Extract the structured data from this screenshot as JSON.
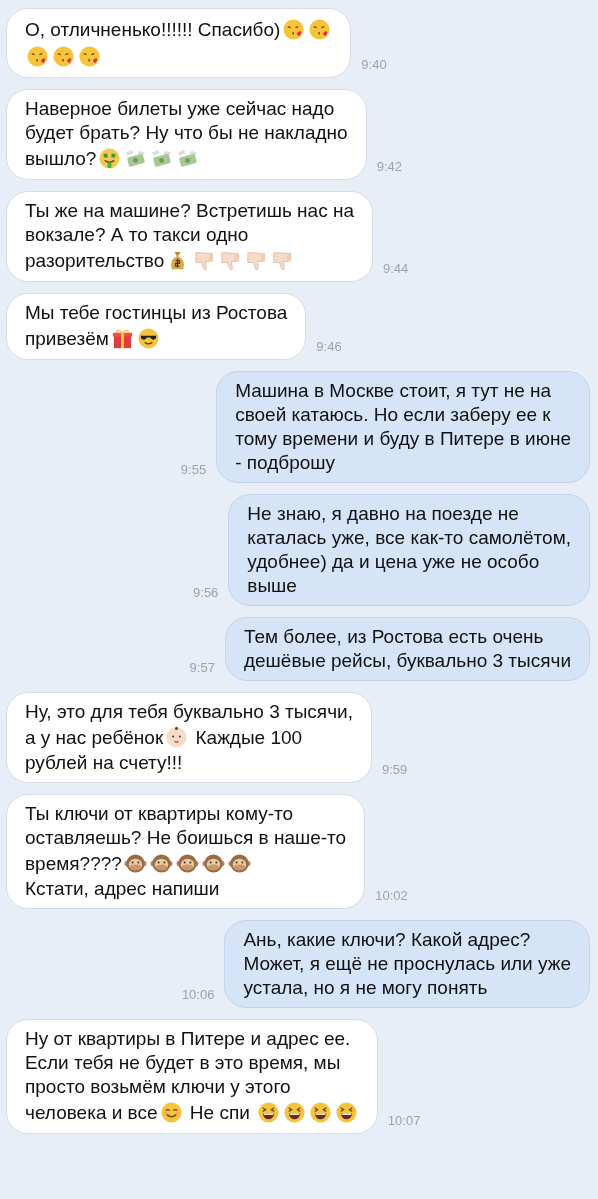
{
  "messages": [
    {
      "outgoing": false,
      "time": "9:40",
      "lines": [
        [
          {
            "kind": "text",
            "text": "О, отличненько!!!!!! Спасибо)"
          },
          {
            "kind": "kiss"
          },
          {
            "kind": "kiss"
          }
        ],
        [
          {
            "kind": "kiss"
          },
          {
            "kind": "kiss"
          },
          {
            "kind": "kiss"
          }
        ]
      ]
    },
    {
      "outgoing": false,
      "time": "9:42",
      "lines": [
        [
          {
            "kind": "text",
            "text": "Наверное билеты уже сейчас надо"
          }
        ],
        [
          {
            "kind": "text",
            "text": "будет брать? Ну что бы не накладно"
          }
        ],
        [
          {
            "kind": "text",
            "text": "вышло?"
          },
          {
            "kind": "money-face"
          },
          {
            "kind": "flying-money"
          },
          {
            "kind": "flying-money"
          },
          {
            "kind": "flying-money"
          }
        ]
      ]
    },
    {
      "outgoing": false,
      "time": "9:44",
      "lines": [
        [
          {
            "kind": "text",
            "text": "Ты же на машине? Встретишь нас на"
          }
        ],
        [
          {
            "kind": "text",
            "text": "вокзале? А то такси одно"
          }
        ],
        [
          {
            "kind": "text",
            "text": "разорительство"
          },
          {
            "kind": "money-bag"
          },
          {
            "kind": "thumbs-down"
          },
          {
            "kind": "thumbs-down"
          },
          {
            "kind": "thumbs-down"
          },
          {
            "kind": "thumbs-down"
          }
        ]
      ]
    },
    {
      "outgoing": false,
      "time": "9:46",
      "lines": [
        [
          {
            "kind": "text",
            "text": "Мы тебе гостинцы из Ростова"
          }
        ],
        [
          {
            "kind": "text",
            "text": "привезём"
          },
          {
            "kind": "gift"
          },
          {
            "kind": "sunglasses"
          }
        ]
      ]
    },
    {
      "outgoing": true,
      "time": "9:55",
      "lines": [
        [
          {
            "kind": "text",
            "text": "Машина в Москве стоит, я тут не на"
          }
        ],
        [
          {
            "kind": "text",
            "text": "своей катаюсь. Но если заберу ее к"
          }
        ],
        [
          {
            "kind": "text",
            "text": "тому времени и буду в Питере в июне"
          }
        ],
        [
          {
            "kind": "text",
            "text": "- подброшу"
          }
        ]
      ]
    },
    {
      "outgoing": true,
      "time": "9:56",
      "lines": [
        [
          {
            "kind": "text",
            "text": "Не знаю, я давно на поезде не"
          }
        ],
        [
          {
            "kind": "text",
            "text": "каталась уже, все как-то самолётом,"
          }
        ],
        [
          {
            "kind": "text",
            "text": "удобнее) да и цена уже не особо"
          }
        ],
        [
          {
            "kind": "text",
            "text": "выше"
          }
        ]
      ]
    },
    {
      "outgoing": true,
      "time": "9:57",
      "lines": [
        [
          {
            "kind": "text",
            "text": "Тем более, из Ростова есть очень"
          }
        ],
        [
          {
            "kind": "text",
            "text": "дешёвые рейсы, буквально 3 тысячи"
          }
        ]
      ]
    },
    {
      "outgoing": false,
      "time": "9:59",
      "lines": [
        [
          {
            "kind": "text",
            "text": "Ну, это для тебя буквально 3 тысячи,"
          }
        ],
        [
          {
            "kind": "text",
            "text": "а у нас ребёнок"
          },
          {
            "kind": "baby"
          },
          {
            "kind": "text",
            "text": "Каждые 100"
          }
        ],
        [
          {
            "kind": "text",
            "text": "рублей на счету!!!"
          }
        ]
      ]
    },
    {
      "outgoing": false,
      "time": "10:02",
      "lines": [
        [
          {
            "kind": "text",
            "text": "Ты ключи от квартиры кому-то"
          }
        ],
        [
          {
            "kind": "text",
            "text": "оставляешь? Не боишься в наше-то"
          }
        ],
        [
          {
            "kind": "text",
            "text": "время????"
          },
          {
            "kind": "monkey"
          },
          {
            "kind": "monkey"
          },
          {
            "kind": "monkey"
          },
          {
            "kind": "monkey"
          },
          {
            "kind": "monkey"
          }
        ],
        [
          {
            "kind": "text",
            "text": "Кстати, адрес напиши"
          }
        ]
      ]
    },
    {
      "outgoing": true,
      "time": "10:06",
      "lines": [
        [
          {
            "kind": "text",
            "text": "Ань, какие ключи? Какой адрес?"
          }
        ],
        [
          {
            "kind": "text",
            "text": "Может, я ещё не проснулась или уже"
          }
        ],
        [
          {
            "kind": "text",
            "text": "устала, но я не могу понять"
          }
        ]
      ]
    },
    {
      "outgoing": false,
      "time": "10:07",
      "lines": [
        [
          {
            "kind": "text",
            "text": "Ну от квартиры в Питере и адрес ее."
          }
        ],
        [
          {
            "kind": "text",
            "text": "Если тебя не будет в это время, мы"
          }
        ],
        [
          {
            "kind": "text",
            "text": "просто возьмём ключи у этого"
          }
        ],
        [
          {
            "kind": "text",
            "text": "человека и все"
          },
          {
            "kind": "smile"
          },
          {
            "kind": "text",
            "text": "Не спи"
          },
          {
            "kind": "laugh"
          },
          {
            "kind": "laugh"
          },
          {
            "kind": "laugh"
          },
          {
            "kind": "laugh"
          }
        ]
      ]
    }
  ]
}
